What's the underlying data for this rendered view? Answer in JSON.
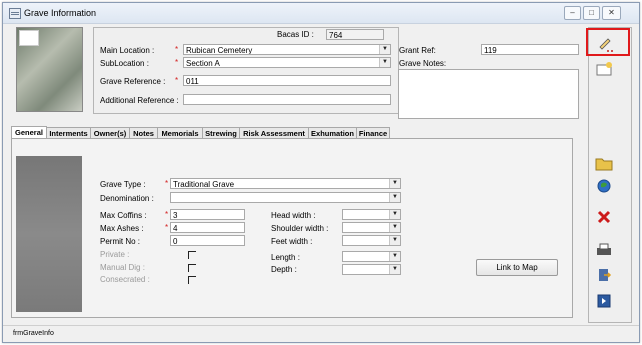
{
  "window": {
    "title": "Grave Information"
  },
  "header": {
    "bacas_id_label": "Bacas ID :",
    "bacas_id_value": "764",
    "main_location_label": "Main Location :",
    "main_location_value": "Rubican Cemetery",
    "sublocation_label": "SubLocation :",
    "sublocation_value": "Section A",
    "grave_reference_label": "Grave Reference :",
    "grave_reference_value": "011",
    "additional_reference_label": "Additional Reference :",
    "additional_reference_value": "",
    "grant_ref_label": "Grant Ref:",
    "grant_ref_value": "119",
    "grave_notes_label": "Grave Notes:",
    "grave_notes_value": ""
  },
  "required_marker": "*",
  "tabs": [
    {
      "label": "General"
    },
    {
      "label": "Interments"
    },
    {
      "label": "Owner(s)"
    },
    {
      "label": "Notes"
    },
    {
      "label": "Memorials"
    },
    {
      "label": "Strewing"
    },
    {
      "label": "Risk Assessment"
    },
    {
      "label": "Exhumation"
    },
    {
      "label": "Finance"
    }
  ],
  "general": {
    "grave_type_label": "Grave Type :",
    "grave_type_value": "Traditional Grave",
    "denomination_label": "Denomination :",
    "denomination_value": "",
    "max_coffins_label": "Max Coffins :",
    "max_coffins_value": "3",
    "max_ashes_label": "Max Ashes :",
    "max_ashes_value": "4",
    "permit_no_label": "Permit No :",
    "permit_no_value": "0",
    "private_label": "Private :",
    "manual_dig_label": "Manual Dig :",
    "consecrated_label": "Consecrated :",
    "head_width_label": "Head width :",
    "shoulder_width_label": "Shoulder width :",
    "feet_width_label": "Feet width :",
    "length_label": "Length :",
    "depth_label": "Depth :",
    "link_to_map_label": "Link to Map"
  },
  "status_bar": {
    "form_name": "frmGraveInfo"
  },
  "sidebar_icons": [
    "edit-pencil-icon",
    "new-record-icon",
    "open-folder-icon",
    "globe-icon",
    "delete-x-icon",
    "print-icon",
    "export-icon",
    "exit-icon"
  ],
  "colors": {
    "highlight_border": "#e0191b",
    "required": "#d21c1c",
    "delete_red": "#cc1a1a"
  }
}
